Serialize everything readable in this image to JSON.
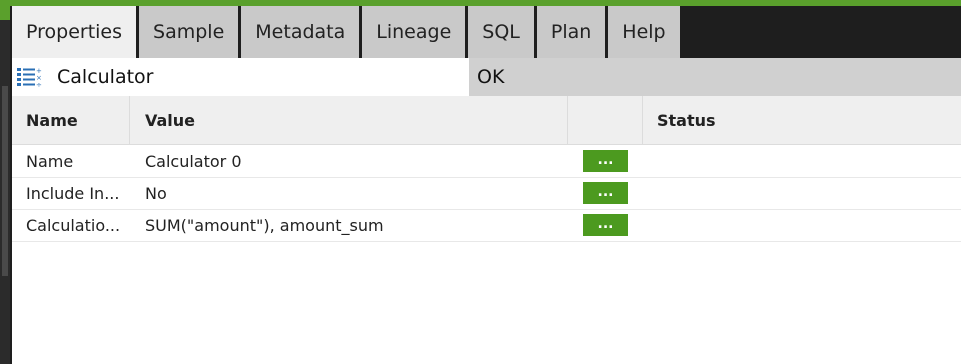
{
  "tabs": [
    {
      "label": "Properties",
      "active": true
    },
    {
      "label": "Sample"
    },
    {
      "label": "Metadata"
    },
    {
      "label": "Lineage"
    },
    {
      "label": "SQL"
    },
    {
      "label": "Plan"
    },
    {
      "label": "Help"
    }
  ],
  "header": {
    "icon": "calculator-list-icon",
    "title": "Calculator",
    "status": "OK"
  },
  "table": {
    "columns": [
      "Name",
      "Value",
      "",
      "Status"
    ],
    "rows": [
      {
        "name": "Name",
        "value": "Calculator 0",
        "button": "...",
        "status": ""
      },
      {
        "name": "Include In...",
        "value": "No",
        "button": "...",
        "status": ""
      },
      {
        "name": "Calculatio...",
        "value": "SUM(\"amount\"), amount_sum",
        "button": "...",
        "status": ""
      }
    ]
  },
  "colors": {
    "accent": "#5aa02c",
    "button": "#4c9a1f",
    "tab_inactive": "#c9c9c9",
    "tab_active": "#efefef"
  }
}
